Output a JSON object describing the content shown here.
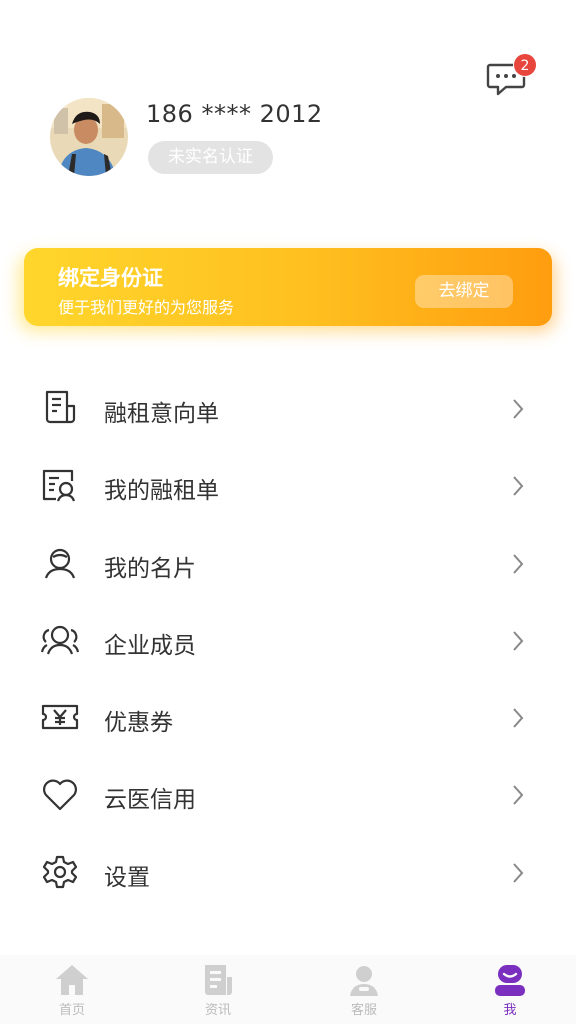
{
  "header": {
    "message_icon": "chat-icon",
    "message_count": "2"
  },
  "profile": {
    "avatar": "user-avatar",
    "phone": "186 **** 2012",
    "verify_status": "未实名认证"
  },
  "banner": {
    "title": "绑定身份证",
    "subtitle": "便于我们更好的为您服务",
    "button": "去绑定",
    "colors": [
      "#ffd62c",
      "#ff9d0f"
    ]
  },
  "menu": {
    "items": [
      {
        "label": "融租意向单",
        "icon": "document-list-icon"
      },
      {
        "label": "我的融租单",
        "icon": "search-document-icon"
      },
      {
        "label": "我的名片",
        "icon": "contact-icon"
      },
      {
        "label": "企业成员",
        "icon": "group-icon"
      },
      {
        "label": "优惠券",
        "icon": "coupon-icon"
      },
      {
        "label": "云医信用",
        "icon": "heart-icon"
      },
      {
        "label": "设置",
        "icon": "gear-icon"
      }
    ]
  },
  "tabbar": {
    "accent": "#7b2fbf",
    "tabs": [
      {
        "label": "首页",
        "icon": "home-icon"
      },
      {
        "label": "资讯",
        "icon": "news-icon"
      },
      {
        "label": "客服",
        "icon": "service-icon"
      },
      {
        "label": "我",
        "icon": "profile-icon",
        "active": true
      }
    ]
  }
}
